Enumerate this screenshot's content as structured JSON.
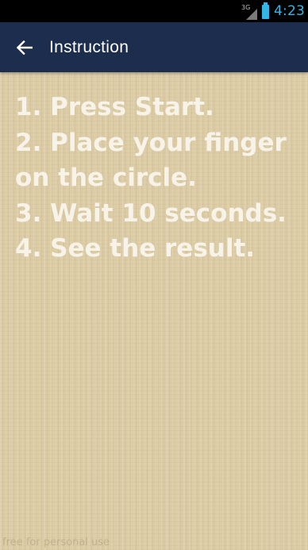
{
  "status_bar": {
    "network_label": "3G",
    "time": "4:23",
    "icons": [
      "network-3g-icon",
      "signal-icon",
      "battery-icon"
    ],
    "accent_color": "#33b5e5"
  },
  "app_bar": {
    "title": "Instruction",
    "back_icon": "arrow-left-icon",
    "background_color": "#1d2d4d"
  },
  "instructions": {
    "steps": [
      "1. Press Start.",
      "2. Place your finger on the circle.",
      "3. Wait 10 seconds.",
      "4. See the result."
    ],
    "text_color": "#f8f3e8",
    "background_color": "#dccca6"
  },
  "watermark": "free for personal use"
}
